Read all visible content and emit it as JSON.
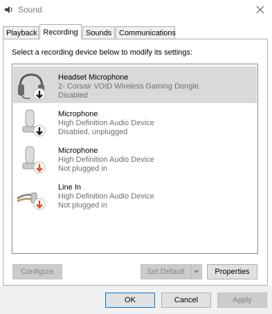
{
  "window": {
    "title": "Sound",
    "app_icon": "speaker-icon",
    "close_icon": "close-icon"
  },
  "tabs": [
    {
      "label": "Playback",
      "active": false
    },
    {
      "label": "Recording",
      "active": true
    },
    {
      "label": "Sounds",
      "active": false
    },
    {
      "label": "Communications",
      "active": false
    }
  ],
  "instruction": "Select a recording device below to modify its settings:",
  "devices": [
    {
      "name": "Headset Microphone",
      "line2": "2- Corsair VOID Wireless Gaming Dongle",
      "line3": "Disabled",
      "icon": "headset-icon",
      "status_icon": "disabled-arrow-icon",
      "selected": true
    },
    {
      "name": "Microphone",
      "line2": "High Definition Audio Device",
      "line3": "Disabled, unplugged",
      "icon": "microphone-icon",
      "status_icon": "disabled-arrow-icon",
      "selected": false
    },
    {
      "name": "Microphone",
      "line2": "High Definition Audio Device",
      "line3": "Not plugged in",
      "icon": "microphone-icon",
      "status_icon": "unplugged-arrow-icon",
      "selected": false
    },
    {
      "name": "Line In",
      "line2": "High Definition Audio Device",
      "line3": "Not plugged in",
      "icon": "line-in-cable-icon",
      "status_icon": "unplugged-arrow-icon",
      "selected": false
    }
  ],
  "buttons": {
    "configure": "Configure",
    "set_default": "Set Default",
    "properties": "Properties",
    "ok": "OK",
    "cancel": "Cancel",
    "apply": "Apply"
  },
  "colors": {
    "selection": "#d9d9d9",
    "secondary_text": "#6d6d6d",
    "focus_border": "#0078d7",
    "status_dark": "#1f1f1f",
    "status_orange": "#d9531e"
  }
}
